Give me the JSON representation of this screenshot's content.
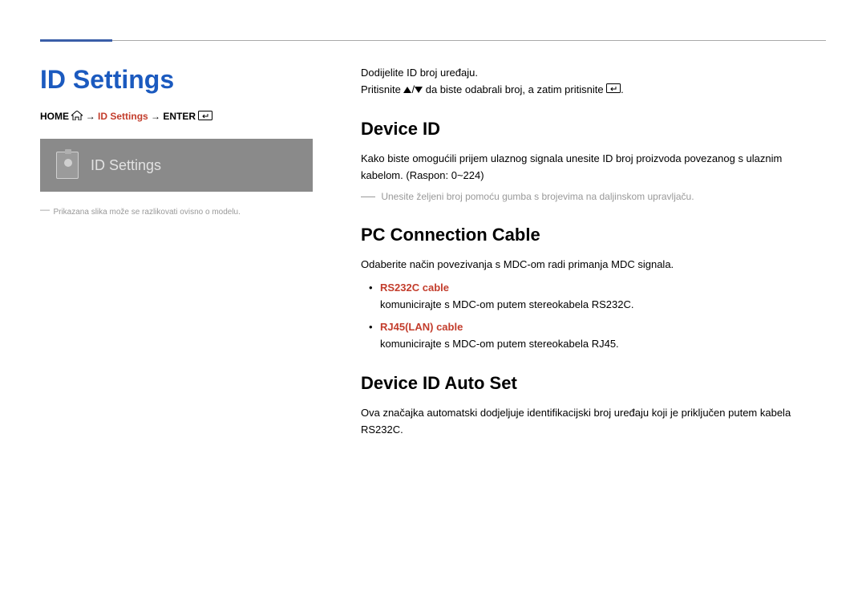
{
  "page": {
    "title": "ID Settings"
  },
  "breadcrumb": {
    "home": "HOME",
    "arrow1": "→",
    "mid": "ID Settings",
    "arrow2": "→",
    "enter": "ENTER"
  },
  "ui_card": {
    "label": "ID Settings"
  },
  "left_footnote": "Prikazana slika može se razlikovati ovisno o modelu.",
  "intro": {
    "line1": "Dodijelite ID broj uređaju.",
    "line2_a": "Pritisnite ",
    "line2_b": " da biste odabrali broj, a zatim pritisnite ",
    "line2_c": "."
  },
  "sections": {
    "device_id": {
      "title": "Device ID",
      "body": "Kako biste omogućili prijem ulaznog signala unesite ID broj proizvoda povezanog s ulaznim kabelom. (Raspon: 0~224)",
      "note": "Unesite željeni broj pomoću gumba s brojevima na daljinskom upravljaču."
    },
    "pc_cable": {
      "title": "PC Connection Cable",
      "body": "Odaberite način povezivanja s MDC-om radi primanja MDC signala.",
      "items": [
        {
          "name": "RS232C cable",
          "desc": "komunicirajte s MDC-om putem stereokabela RS232C."
        },
        {
          "name": "RJ45(LAN) cable",
          "desc": "komunicirajte s MDC-om putem stereokabela RJ45."
        }
      ]
    },
    "auto_set": {
      "title": "Device ID Auto Set",
      "body": "Ova značajka automatski dodjeljuje identifikacijski broj uređaju koji je priključen putem kabela RS232C."
    }
  }
}
